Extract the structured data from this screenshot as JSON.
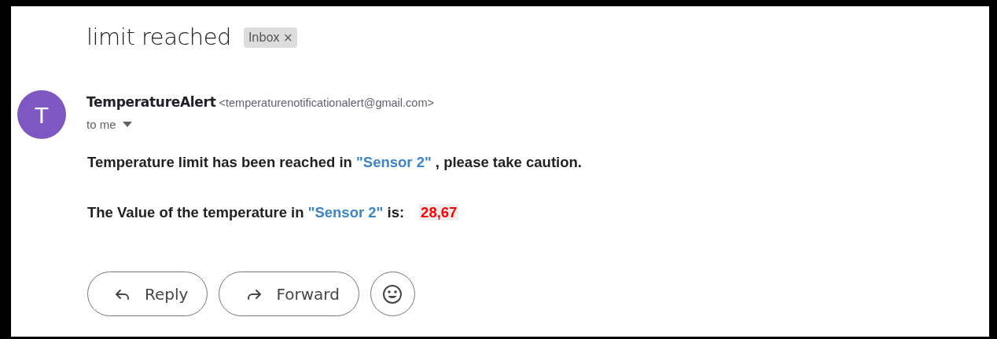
{
  "subject": "limit reached",
  "label": {
    "text": "Inbox",
    "close": "×"
  },
  "sender": {
    "initial": "T",
    "color": "#7e57c2",
    "name": "TemperatureAlert",
    "email": "<temperaturenotificationalert@gmail.com>",
    "recipient": "to me"
  },
  "body": [
    {
      "segments": [
        {
          "kind": "plain",
          "text": "Temperature limit has been reached in "
        },
        {
          "kind": "highlight",
          "text": "\"Sensor 2\""
        },
        {
          "kind": "plain",
          "text": " , please take caution."
        }
      ]
    },
    {
      "segments": [
        {
          "kind": "plain",
          "text": "The Value of the temperature in "
        },
        {
          "kind": "highlight",
          "text": "\"Sensor 2\""
        },
        {
          "kind": "plain",
          "text": " is:"
        },
        {
          "kind": "value",
          "text": "28,67"
        }
      ]
    }
  ],
  "actions": [
    {
      "kind": "reply",
      "label": "Reply"
    },
    {
      "kind": "forward",
      "label": "Forward"
    },
    {
      "kind": "emoji"
    }
  ]
}
